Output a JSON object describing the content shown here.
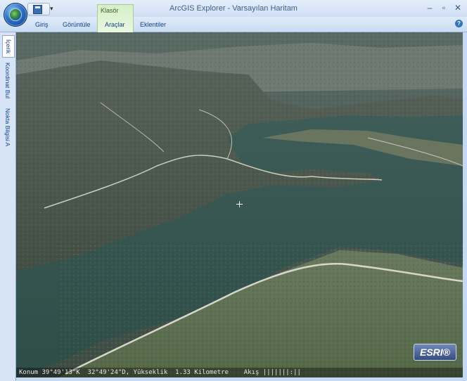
{
  "window": {
    "title": "ArcGIS Explorer - Varsayılan Haritam",
    "controls": [
      "–",
      "▫",
      "✕"
    ]
  },
  "quick_access": {
    "save_icon": "save-icon",
    "dropdown": "▾"
  },
  "ribbon": {
    "context_label": "Klasör",
    "tabs": [
      "Giriş",
      "Görüntüle",
      "Araçlar",
      "Eklentiler"
    ],
    "help": "?"
  },
  "sidebar": {
    "tabs": [
      "İçerik",
      "Koordinat Bul",
      "Nokta Bilgisi A"
    ]
  },
  "map": {
    "logo": "ESRI®",
    "status": "Konum 39°49'13\"K  32°49'24\"D, Yükseklik  1.33 Kilometre    Akış |||||||:||"
  }
}
